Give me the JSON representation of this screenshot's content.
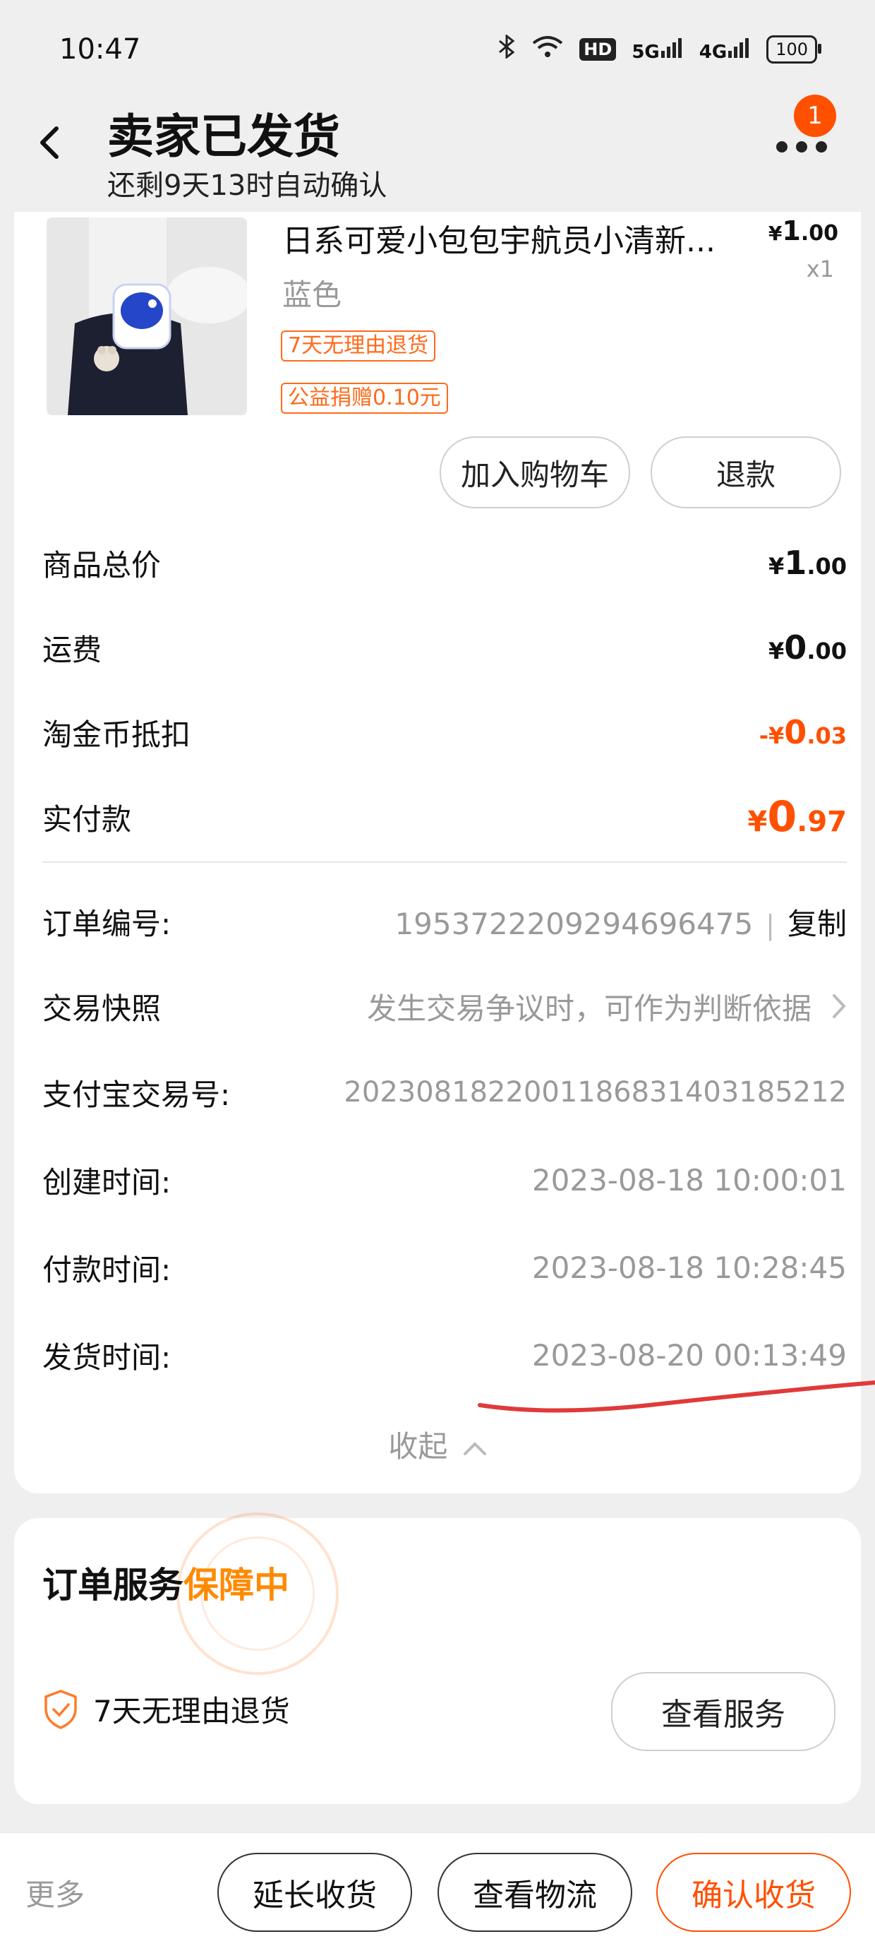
{
  "status_bar": {
    "time": "10:47",
    "hd_label": "HD",
    "net_5g": "5G",
    "net_4g": "4G",
    "battery": "100"
  },
  "header": {
    "title": "卖家已发货",
    "subtitle": "还剩9天13时自动确认",
    "notification_count": "1"
  },
  "product": {
    "title": "日系可爱小包包宇航员小清新...",
    "price_symbol": "¥",
    "price_int": "1",
    "price_dec": ".00",
    "quantity": "x1",
    "spec": "蓝色",
    "tags": [
      "7天无理由退货",
      "公益捐赠0.10元"
    ],
    "add_to_cart": "加入购物车",
    "refund": "退款"
  },
  "summary": {
    "rows": [
      {
        "label": "商品总价",
        "prefix": "¥",
        "int": "1",
        "dec": ".00"
      },
      {
        "label": "运费",
        "prefix": "¥",
        "int": "0",
        "dec": ".00"
      },
      {
        "label": "淘金币抵扣",
        "prefix": "-¥",
        "int": "0",
        "dec": ".03"
      },
      {
        "label": "实付款",
        "prefix": "¥",
        "int": "0",
        "dec": ".97"
      }
    ]
  },
  "order_info": {
    "order_no_label": "订单编号:",
    "order_no": "1953722209294696475",
    "copy": "复制",
    "snapshot_label": "交易快照",
    "snapshot_hint": "发生交易争议时，可作为判断依据",
    "alipay_label": "支付宝交易号:",
    "alipay_no": "2023081822001186831403185212",
    "created_label": "创建时间:",
    "created": "2023-08-18 10:00:01",
    "paid_label": "付款时间:",
    "paid": "2023-08-18 10:28:45",
    "shipped_label": "发货时间:",
    "shipped": "2023-08-20 00:13:49",
    "collapse": "收起"
  },
  "service": {
    "title_prefix": "订单服务",
    "title_status": "保障中",
    "item": "7天无理由退货",
    "view_button": "查看服务"
  },
  "bottom_bar": {
    "more": "更多",
    "extend": "延长收货",
    "logistics": "查看物流",
    "confirm": "确认收货"
  },
  "colors": {
    "accent": "#ff5000",
    "guard": "#ff8a00",
    "annotation_line": "#e03a3a"
  }
}
